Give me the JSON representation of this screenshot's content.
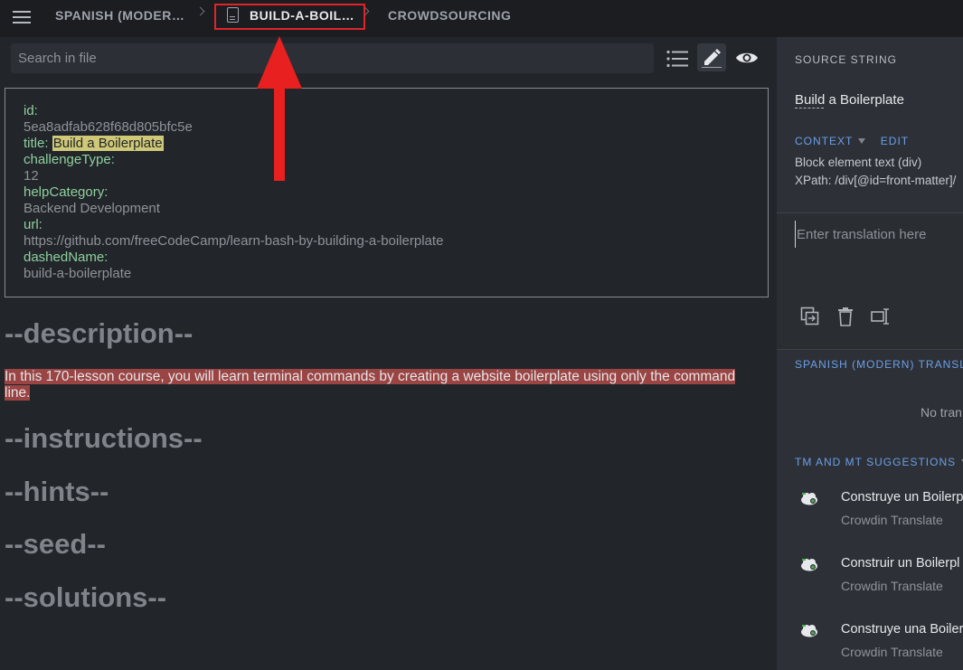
{
  "breadcrumbs": [
    {
      "label": "SPANISH (MODER…"
    },
    {
      "label": "BUILD-A-BOIL…"
    },
    {
      "label": "CROWDSOURCING"
    }
  ],
  "search": {
    "placeholder": "Search in file",
    "value": ""
  },
  "toolbar": {
    "icons": [
      "list-icon",
      "pencil-icon",
      "eye-icon"
    ],
    "selected": "pencil-icon"
  },
  "front_matter": [
    {
      "key": "id:",
      "value": "5ea8adfab628f68d805bfc5e"
    },
    {
      "key": "title:",
      "value": "Build a Boilerplate"
    },
    {
      "key": "challengeType:",
      "value": "12"
    },
    {
      "key": "helpCategory:",
      "value": "Backend Development"
    },
    {
      "key": "url:",
      "value": "https://github.com/freeCodeCamp/learn-bash-by-building-a-boilerplate"
    },
    {
      "key": "dashedName:",
      "value": "build-a-boilerplate"
    }
  ],
  "sections": {
    "description": "--description--",
    "description_text": "In this 170-lesson course, you will learn terminal commands by creating a website boilerplate using only the command line.",
    "instructions": "--instructions--",
    "hints": "--hints--",
    "seed": "--seed--",
    "solutions": "--solutions--"
  },
  "panel": {
    "source_header": "SOURCE STRING",
    "source_string": "Build a Boilerplate",
    "context_label": "CONTEXT",
    "edit_label": "EDIT",
    "context_line1": "Block element text (div)",
    "context_line2": "XPath: /div[@id=front-matter]/",
    "translation_placeholder": "Enter translation here",
    "translations_header": "SPANISH (MODERN) TRANSLA",
    "no_translations": "No tran",
    "suggestions_header": "TM AND MT SUGGESTIONS",
    "suggestions": [
      {
        "text": "Construye un Boilerp",
        "source": "Crowdin Translate"
      },
      {
        "text": "Construir un Boilerpl",
        "source": "Crowdin Translate"
      },
      {
        "text": "Construye una Boiler",
        "source": "Crowdin Translate"
      }
    ]
  },
  "colors": {
    "highlight_border": "#e0242a",
    "arrow": "#e8201f",
    "accent_link": "#6b9ee8",
    "key_green": "#8fd19e",
    "title_highlight": "#cfc877",
    "description_highlight": "#9a4444"
  }
}
